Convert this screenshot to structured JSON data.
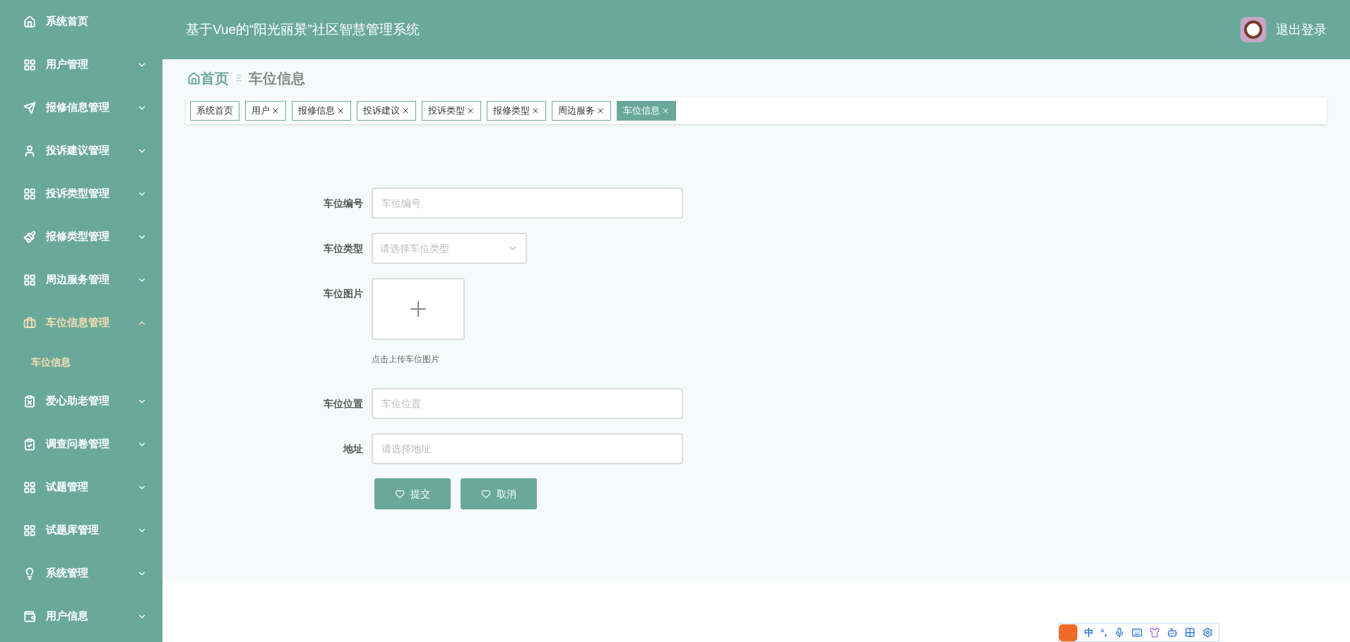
{
  "sidebar": {
    "items": [
      {
        "label": "系统首页",
        "kind": "link",
        "selected": false
      },
      {
        "label": "用户管理",
        "kind": "menu",
        "expanded": false,
        "selected": false
      },
      {
        "label": "报修信息管理",
        "kind": "menu",
        "expanded": false,
        "selected": false
      },
      {
        "label": "投诉建议管理",
        "kind": "menu",
        "expanded": false,
        "selected": false
      },
      {
        "label": "投诉类型管理",
        "kind": "menu",
        "expanded": false,
        "selected": false
      },
      {
        "label": "报修类型管理",
        "kind": "menu",
        "expanded": false,
        "selected": false
      },
      {
        "label": "周边服务管理",
        "kind": "menu",
        "expanded": false,
        "selected": false
      },
      {
        "label": "车位信息管理",
        "kind": "menu",
        "expanded": true,
        "selected": true,
        "children": [
          {
            "label": "车位信息",
            "selected": true
          }
        ]
      },
      {
        "label": "爱心助老管理",
        "kind": "menu",
        "expanded": false,
        "selected": false
      },
      {
        "label": "调查问卷管理",
        "kind": "menu",
        "expanded": false,
        "selected": false
      },
      {
        "label": "试题管理",
        "kind": "menu",
        "expanded": false,
        "selected": false
      },
      {
        "label": "试题库管理",
        "kind": "menu",
        "expanded": false,
        "selected": false
      },
      {
        "label": "系统管理",
        "kind": "menu",
        "expanded": false,
        "selected": false
      },
      {
        "label": "用户信息",
        "kind": "menu",
        "expanded": false,
        "selected": false
      }
    ]
  },
  "header": {
    "title": "基于Vue的“阳光丽景”社区智慧管理系统",
    "logout": "退出登录"
  },
  "breadcrumb": {
    "home": "首页",
    "separator": "Ξ",
    "current": "车位信息"
  },
  "tags": [
    {
      "label": "系统首页",
      "closable": false,
      "selected": false
    },
    {
      "label": "用户",
      "closable": true,
      "selected": false
    },
    {
      "label": "报修信息",
      "closable": true,
      "selected": false
    },
    {
      "label": "投诉建议",
      "closable": true,
      "selected": false
    },
    {
      "label": "投诉类型",
      "closable": true,
      "selected": false
    },
    {
      "label": "报修类型",
      "closable": true,
      "selected": false
    },
    {
      "label": "周边服务",
      "closable": true,
      "selected": false
    },
    {
      "label": "车位信息",
      "closable": true,
      "selected": true
    }
  ],
  "form": {
    "fields": [
      {
        "kind": "input",
        "label": "车位编号",
        "placeholder": "车位编号"
      },
      {
        "kind": "select",
        "label": "车位类型",
        "placeholder": "请选择车位类型"
      },
      {
        "kind": "upload",
        "label": "车位图片",
        "hint": "点击上传车位图片"
      },
      {
        "kind": "input",
        "label": "车位位置",
        "placeholder": "车位位置"
      },
      {
        "kind": "input",
        "label": "地址",
        "placeholder": "请选择地址"
      }
    ],
    "buttons": [
      "提交",
      "取消"
    ]
  },
  "ime_bar": {
    "items": [
      "中",
      "°,"
    ]
  }
}
